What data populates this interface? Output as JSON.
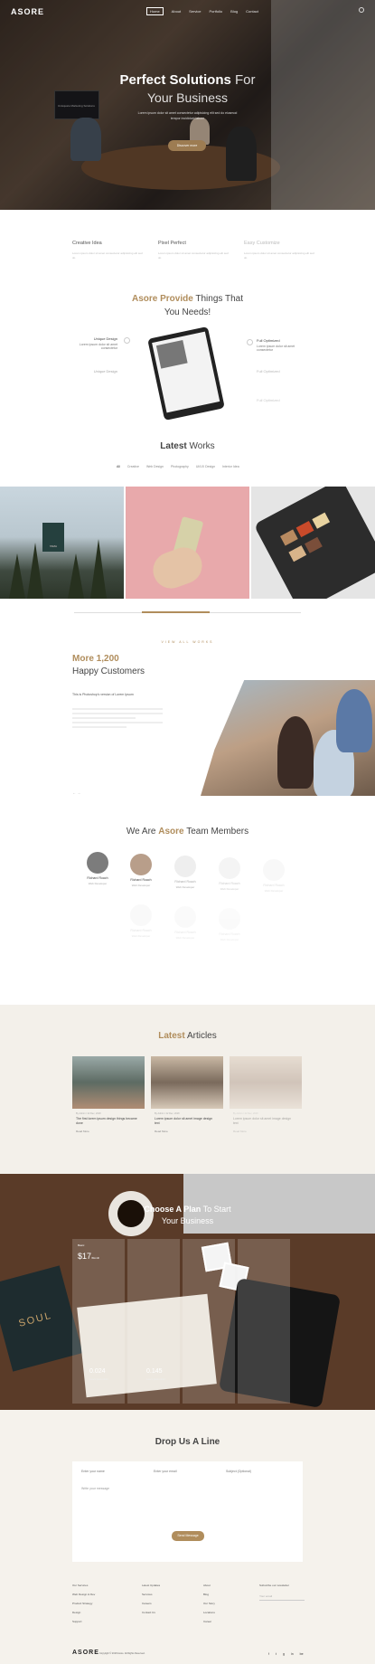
{
  "nav": {
    "logo": "ASORE",
    "menu": [
      "Home",
      "About",
      "Service",
      "Portfolio",
      "Blog",
      "Contact"
    ]
  },
  "hero": {
    "title_bold": "Perfect Solutions",
    "title_thin": "For",
    "subtitle": "Your Business",
    "description": "Lorem ipsum dolor sit amet consectetur adipisicing elit sed do eiusmod tempor incididunt labore",
    "button": "Discover more",
    "screen_text": "Unisquare Marketing Solutions"
  },
  "features": [
    {
      "title": "Creative Idea",
      "desc": "Lorem ipsum dolor sit amet consectetur adipisicing elit sed do"
    },
    {
      "title": "Pixel Perfect",
      "desc": "Lorem ipsum dolor sit amet consectetur adipisicing elit sed do"
    },
    {
      "title": "Easy Customize",
      "desc": "Lorem ipsum dolor sit amet consectetur adipisicing elit sed do"
    }
  ],
  "provide": {
    "title_bold": "Asore Provide",
    "title_rest": "Things That",
    "title_line2": "You Needs!",
    "left": [
      {
        "title": "Unique Design",
        "desc": "Lorem ipsum dolor sit amet consectetur"
      },
      {
        "title": "Unique Design",
        "desc": ""
      }
    ],
    "right": [
      {
        "title": "Full Optimized",
        "desc": "Lorem ipsum dolor sit amet consectetur"
      },
      {
        "title": "Full Optimized",
        "desc": ""
      },
      {
        "title": "Full Optimized",
        "desc": ""
      }
    ]
  },
  "works": {
    "title_bold": "Latest",
    "title_rest": "Works",
    "filters": [
      "All",
      "Creative",
      "Web Design",
      "Photography",
      "UI/UX Design",
      "Interior Idea"
    ],
    "badge": "TAMA",
    "view_all": "VIEW ALL WORKS"
  },
  "customers": {
    "number": "More 1,200",
    "label": "Happy Customers",
    "quote": "This is Photoshop's version of Lorem Ipsum"
  },
  "team": {
    "title_bold": "Asore",
    "title_pre": "We Are",
    "title_rest": "Team Members",
    "members": [
      {
        "name": "Richard Roach",
        "role": "Web Developer"
      },
      {
        "name": "Richard Roach",
        "role": "Web Developer"
      },
      {
        "name": "Richard Roach",
        "role": "Web Developer"
      },
      {
        "name": "Richard Roach",
        "role": "Web Developer"
      },
      {
        "name": "Richard Roach",
        "role": "Web Developer"
      },
      {
        "name": "Richard Roach",
        "role": "Web Developer"
      },
      {
        "name": "Richard Roach",
        "role": "Web Developer"
      },
      {
        "name": "Richard Roach",
        "role": "Web Developer"
      }
    ]
  },
  "articles": {
    "title_bold": "Latest",
    "title_rest": "Articles",
    "items": [
      {
        "meta": "By Admin / 22 Dec, 2018",
        "title": "The first lorem ipsum design things became done",
        "more": "Read More"
      },
      {
        "meta": "By Admin / 22 Dec, 2018",
        "title": "Lorem ipsum dolor sit amet image design text",
        "more": "Read More"
      },
      {
        "meta": "By Admin / 22 Dec, 2018",
        "title": "Lorem ipsum dolor sit amet image design text",
        "more": "Read More"
      }
    ]
  },
  "plan": {
    "title_bold": "Choose A Plan",
    "title_rest": "To Start",
    "title_line2": "Your Business",
    "card_label": "Basic",
    "price": "$17",
    "price_unit": "/Month",
    "stat1": "0.024",
    "stat1_label": "Lorem ipsum dolor",
    "stat2": "0.145",
    "stat2_label": "Lorem ipsum dolor"
  },
  "contact": {
    "title": "Drop Us A Line",
    "fields": [
      "Enter your name",
      "Enter your email",
      "Subject (Optional)"
    ],
    "message": "Write your message",
    "send": "Send Message"
  },
  "footer": {
    "col1": [
      "Our Services",
      "Web Design & Dev",
      "Product Strategy",
      "Design",
      "Support"
    ],
    "col2": [
      "Latest Updates",
      "Services",
      "Careers",
      "Contact Us"
    ],
    "col3": [
      "About",
      "Blog",
      "Our Story",
      "Locations",
      "Career"
    ],
    "newsletter_title": "Subscribe our newsletter",
    "newsletter_placeholder": "Your email",
    "logo": "ASORE",
    "copyright": "Copyright © 2018 Asore. All Rights Reserved.",
    "social": [
      "f",
      "t",
      "g",
      "in",
      "be"
    ]
  },
  "colors": {
    "accent": "#b08d5c",
    "articles_bg": "#f3f0ea",
    "contact_bg": "#f5f2ec"
  }
}
